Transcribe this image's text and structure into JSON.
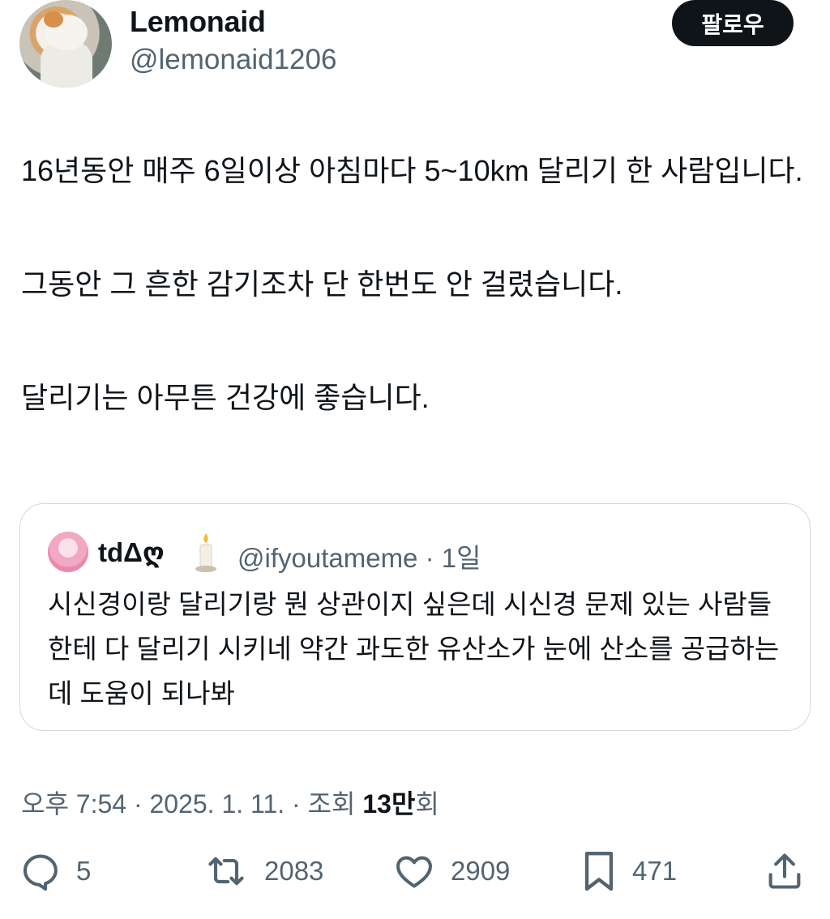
{
  "author": {
    "display_name": "Lemonaid",
    "handle": "@lemonaid1206"
  },
  "follow_button": {
    "label": "팔로우"
  },
  "tweet": {
    "paragraphs": [
      "16년동안 매주 6일이상 아침마다 5~10km 달리기 한 사람입니다.",
      "그동안 그 흔한 감기조차 단 한번도 안 걸렸습니다.",
      "달리기는 아무튼 건강에 좋습니다."
    ]
  },
  "quoted_tweet": {
    "display_name": "tdΔღ",
    "handle_time": "@ifyoutameme · 1일",
    "text": "시신경이랑 달리기랑 뭔 상관이지 싶은데 시신경 문제 있는 사람들한테 다 달리기 시키네 약간 과도한 유산소가 눈에 산소를 공급하는 데 도움이 되나봐"
  },
  "meta": {
    "time_date": "오후 7:54 · 2025. 1. 11. · 조회 ",
    "views_bold": "13만",
    "views_suffix": "회"
  },
  "actions": {
    "replies": "5",
    "retweets": "2083",
    "likes": "2909",
    "bookmarks": "471"
  },
  "icons": [
    "reply-icon",
    "retweet-icon",
    "like-icon",
    "bookmark-icon",
    "share-icon",
    "candle-icon"
  ],
  "colors": {
    "text": "#0f1419",
    "secondary": "#536471",
    "border": "#cfd9de",
    "button_bg": "#0f1419"
  }
}
